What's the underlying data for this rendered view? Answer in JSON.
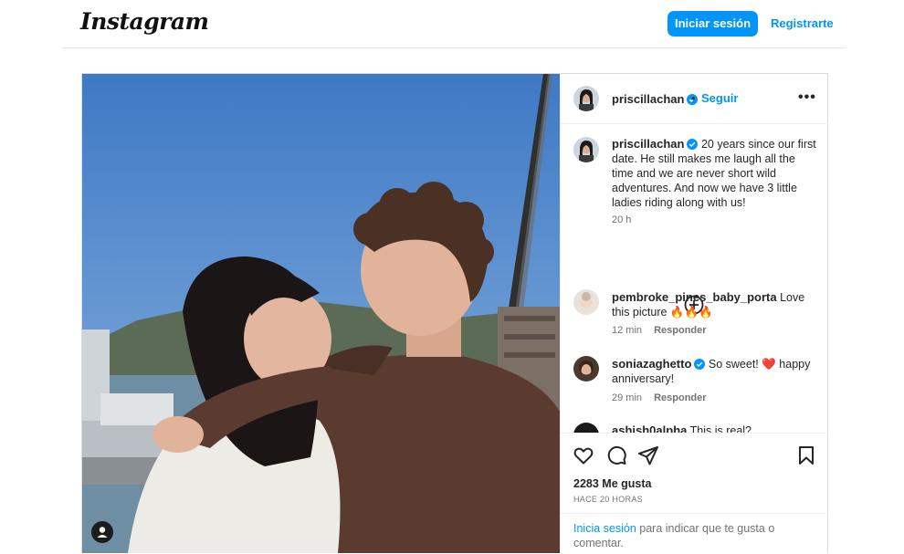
{
  "header": {
    "logo_text": "Instagram",
    "login_button": "Iniciar sesión",
    "register_link": "Registrarte"
  },
  "post": {
    "author": "priscillachan",
    "follow_label": "Seguir",
    "dot": "•",
    "more_label": "•••",
    "caption": "20 years since our first date. He still makes me laugh all the time and we are never short wild adventures. And now we have 3 little ladies riding along with us!",
    "caption_time": "20 h",
    "comments": [
      {
        "user": "pembroke_pines_baby_porta",
        "text": "Love this picture 🔥🔥🔥",
        "time": "12 min",
        "reply": "Responder"
      },
      {
        "user": "soniazaghetto",
        "verified": true,
        "text": "So sweet! ❤️ happy anniversary!",
        "time": "29 min",
        "reply": "Responder"
      },
      {
        "user": "ashish0alpha",
        "text": "This is real?"
      }
    ],
    "likes": "2283 Me gusta",
    "time_ago": "HACE 20 HORAS",
    "login_prompt_link": "Inicia sesión",
    "login_prompt_rest": " para indicar que te gusta o comentar."
  },
  "icons": [
    "verified-badge-icon",
    "more-options-icon",
    "load-more-comments-icon",
    "heart-icon",
    "comment-icon",
    "share-icon",
    "bookmark-icon",
    "user-tag-icon"
  ],
  "colors": {
    "accent": "#0095f6",
    "text": "#262626",
    "muted": "#737373",
    "border": "#dbdbdb"
  }
}
